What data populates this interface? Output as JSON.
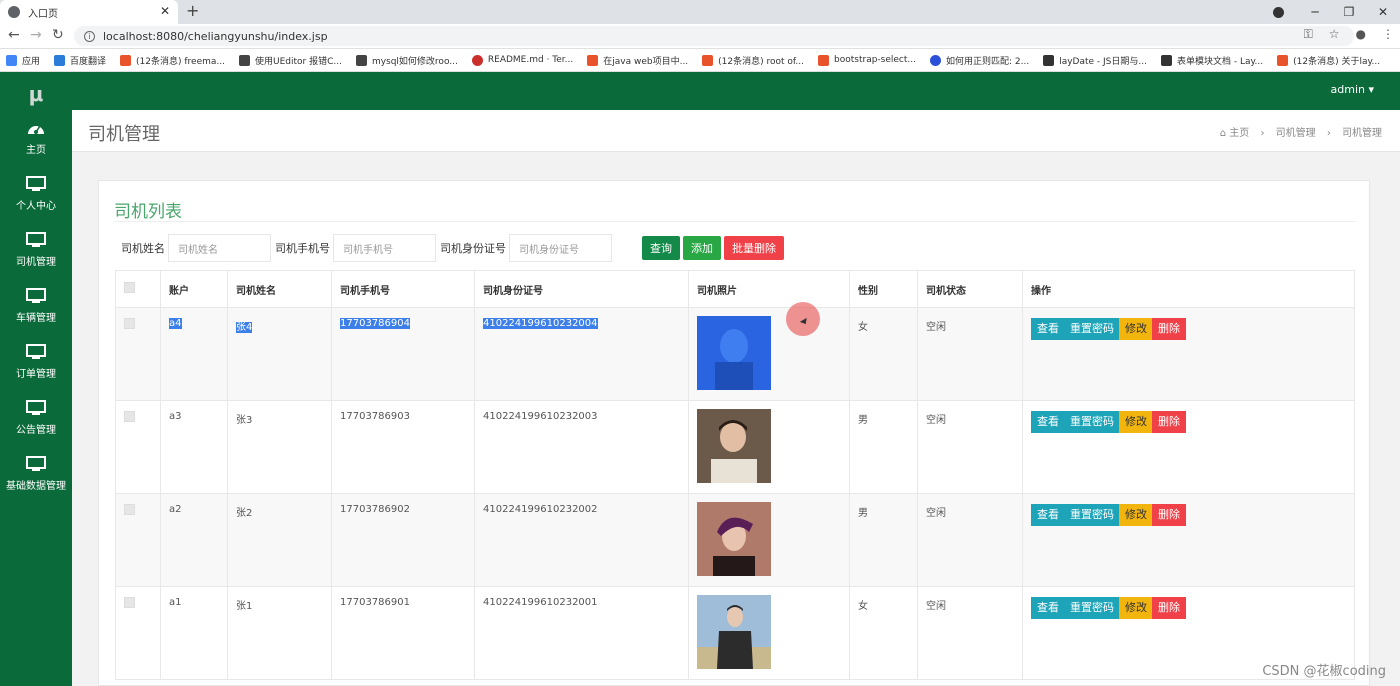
{
  "browser": {
    "tab_title": "入口页",
    "url": "localhost:8080/cheliangyunshu/index.jsp",
    "bookmarks": [
      {
        "label": "应用",
        "color": "#4285f4"
      },
      {
        "label": "百度翻译",
        "color": "#2b7bd9"
      },
      {
        "label": "(12条消息) freema...",
        "color": "#e8532b"
      },
      {
        "label": "使用UEditor 报错C...",
        "color": "#444444"
      },
      {
        "label": "mysql如何修改roo...",
        "color": "#444444"
      },
      {
        "label": "README.md · Ter...",
        "color": "#c9302c"
      },
      {
        "label": "在java web项目中...",
        "color": "#e8532b"
      },
      {
        "label": "(12条消息) root of...",
        "color": "#e8532b"
      },
      {
        "label": "bootstrap-select...",
        "color": "#e8532b"
      },
      {
        "label": "如何用正则匹配: 2...",
        "color": "#2b4fd9"
      },
      {
        "label": "layDate - JS日期与...",
        "color": "#333333"
      },
      {
        "label": "表单模块文档 - Lay...",
        "color": "#333333"
      },
      {
        "label": "(12条消息) 关于lay...",
        "color": "#e8532b"
      }
    ]
  },
  "app": {
    "logo": "μ",
    "user": "admin",
    "sidebar": [
      {
        "label": "主页",
        "icon": "dashboard-icon"
      },
      {
        "label": "个人中心",
        "icon": "monitor-icon"
      },
      {
        "label": "司机管理",
        "icon": "monitor-icon"
      },
      {
        "label": "车辆管理",
        "icon": "monitor-icon"
      },
      {
        "label": "订单管理",
        "icon": "monitor-icon"
      },
      {
        "label": "公告管理",
        "icon": "monitor-icon"
      },
      {
        "label": "基础数据管理",
        "icon": "monitor-icon"
      }
    ],
    "page_title": "司机管理",
    "breadcrumb": [
      "主页",
      "司机管理",
      "司机管理"
    ]
  },
  "panel": {
    "title": "司机列表",
    "search": {
      "name_label": "司机姓名",
      "name_placeholder": "司机姓名",
      "phone_label": "司机手机号",
      "phone_placeholder": "司机手机号",
      "id_label": "司机身份证号",
      "id_placeholder": "司机身份证号",
      "query": "查询",
      "add": "添加",
      "batch_delete": "批量删除"
    },
    "columns": [
      "账户",
      "司机姓名",
      "司机手机号",
      "司机身份证号",
      "司机照片",
      "性别",
      "司机状态",
      "操作"
    ],
    "rows": [
      {
        "account": "a4",
        "name": "张4",
        "phone": "17703786904",
        "id_card": "410224199610232004",
        "photo": "photo-blue",
        "gender": "女",
        "status": "空闲"
      },
      {
        "account": "a3",
        "name": "张3",
        "phone": "17703786903",
        "id_card": "410224199610232003",
        "photo": "photo-boy",
        "gender": "男",
        "status": "空闲"
      },
      {
        "account": "a2",
        "name": "张2",
        "phone": "17703786902",
        "id_card": "410224199610232002",
        "photo": "photo-purple",
        "gender": "男",
        "status": "空闲"
      },
      {
        "account": "a1",
        "name": "张1",
        "phone": "17703786901",
        "id_card": "410224199610232001",
        "photo": "photo-jacket",
        "gender": "女",
        "status": "空闲"
      }
    ],
    "ops": {
      "view": "查看",
      "reset": "重置密码",
      "edit": "修改",
      "delete": "删除"
    }
  },
  "watermark": "CSDN @花椒coding"
}
